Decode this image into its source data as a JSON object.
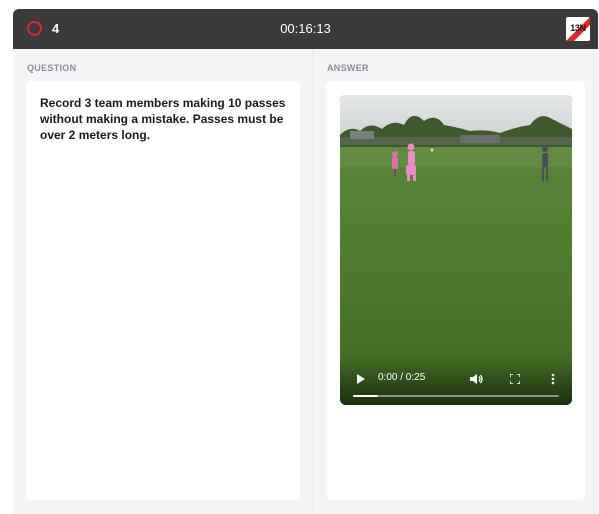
{
  "header": {
    "score": "4",
    "timer": "00:16:13",
    "badge_text": "13N",
    "accent_color": "#e0262b"
  },
  "question": {
    "label": "QUESTION",
    "text": "Record 3 team members making 10 passes without making a mistake. Passes must be over 2 meters long."
  },
  "answer": {
    "label": "ANSWER",
    "video": {
      "time": "0:00 / 0:25",
      "progress_fraction": 0.12
    }
  }
}
